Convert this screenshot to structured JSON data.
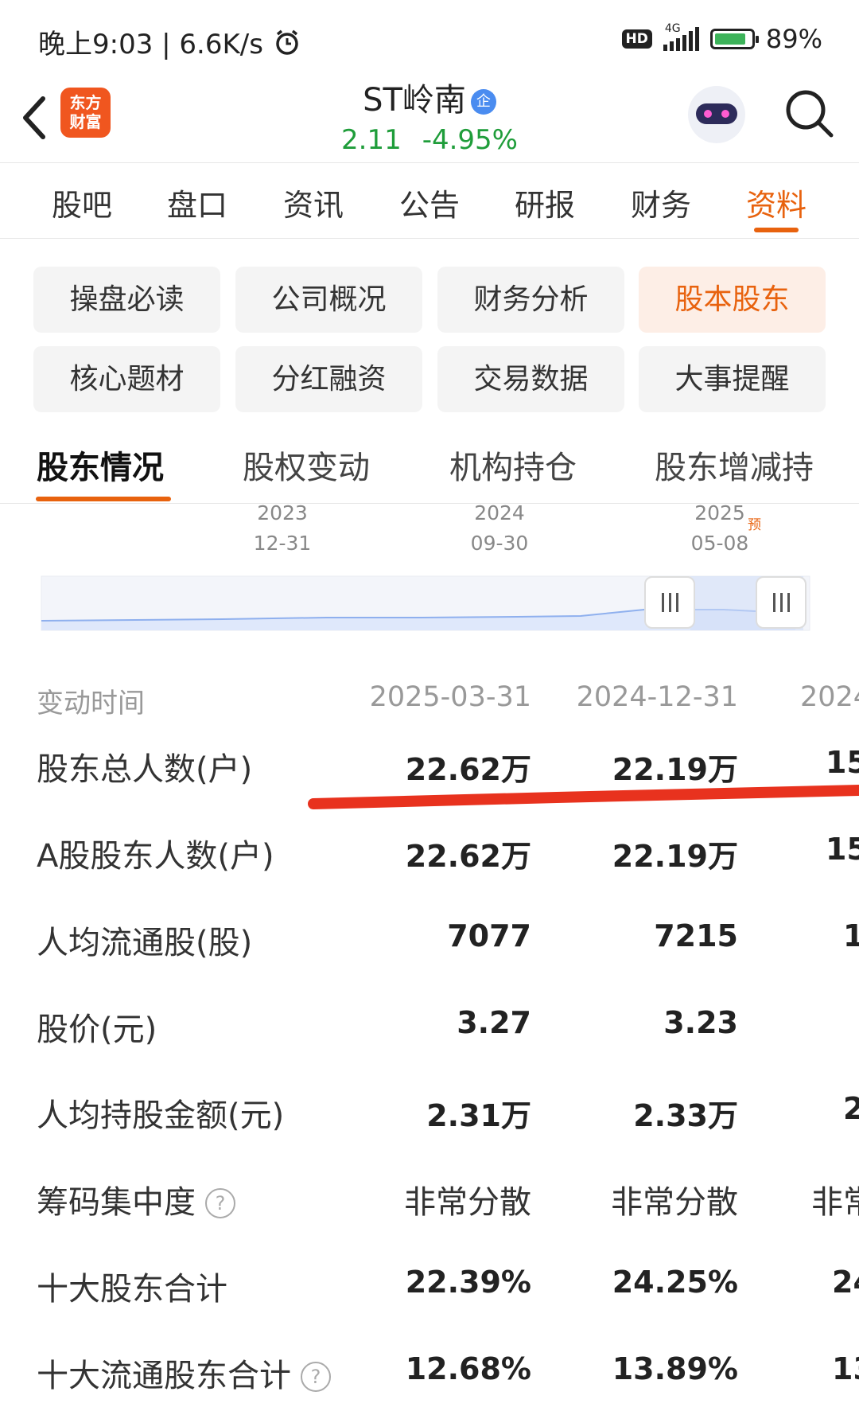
{
  "status_bar": {
    "time_speed": "晚上9:03 | 6.6K/s",
    "hd": "HD",
    "network": "4G",
    "battery_pct": "89%"
  },
  "header": {
    "logo_text_1": "东方",
    "logo_text_2": "财富",
    "stock_name": "ST岭南",
    "qi_badge": "企",
    "price": "2.11",
    "change_pct": "-4.95%"
  },
  "main_tabs": [
    "股吧",
    "盘口",
    "资讯",
    "公告",
    "研报",
    "财务",
    "资料"
  ],
  "sections": {
    "row1": [
      "操盘必读",
      "公司概况",
      "财务分析",
      "股本股东"
    ],
    "row2": [
      "核心题材",
      "分红融资",
      "交易数据",
      "大事提醒"
    ]
  },
  "sub_tabs": [
    "股东情况",
    "股权变动",
    "机构持仓",
    "股东增减持"
  ],
  "timeline": {
    "dates": [
      {
        "year": "2023",
        "md": "12-31"
      },
      {
        "year": "2024",
        "md": "09-30"
      },
      {
        "year": "2025",
        "md": "05-08"
      }
    ],
    "forecast_mark": "预"
  },
  "table": {
    "header_label": "变动时间",
    "columns": [
      "2025-03-31",
      "2024-12-31",
      "2024"
    ],
    "rows": [
      {
        "label": "股东总人数(户)",
        "values": [
          "22.62万",
          "22.19万",
          "15"
        ]
      },
      {
        "label": "A股股东人数(户)",
        "values": [
          "22.62万",
          "22.19万",
          "15"
        ]
      },
      {
        "label": "人均流通股(股)",
        "values": [
          "7077",
          "7215",
          "1"
        ]
      },
      {
        "label": "股价(元)",
        "values": [
          "3.27",
          "3.23",
          ""
        ]
      },
      {
        "label": "人均持股金额(元)",
        "values": [
          "2.31万",
          "2.33万",
          "2"
        ]
      },
      {
        "label": "筹码集中度",
        "values": [
          "非常分散",
          "非常分散",
          "非常"
        ],
        "help": "?"
      },
      {
        "label": "十大股东合计",
        "values": [
          "22.39%",
          "24.25%",
          "24"
        ]
      },
      {
        "label": "十大流通股东合计",
        "values": [
          "12.68%",
          "13.89%",
          "13"
        ],
        "help": "?"
      }
    ]
  },
  "colors": {
    "accent": "#e8620e",
    "down": "#1f9d3a",
    "annotation": "#e8321e"
  }
}
